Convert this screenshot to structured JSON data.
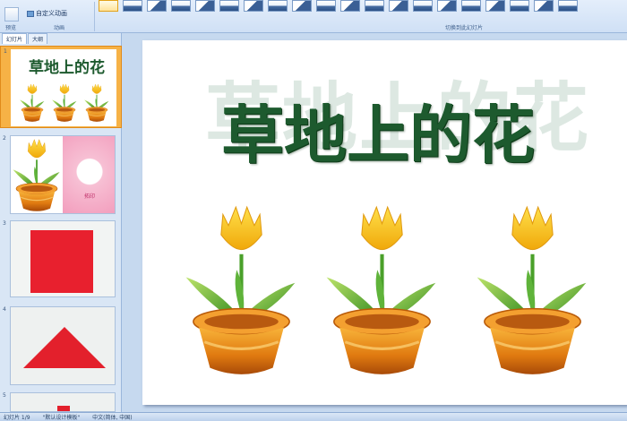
{
  "ribbon": {
    "custom_animation_label": "自定义动画",
    "group_preview_label": "预览",
    "group_animation_label": "动画",
    "group_transition_label": "切换到此幻灯片"
  },
  "left_pane": {
    "tab_slides": "幻灯片",
    "tab_outline": "大纲",
    "slides": [
      {
        "number": "1",
        "title": "草地上的花"
      },
      {
        "number": "2",
        "caption": "拓印"
      },
      {
        "number": "3"
      },
      {
        "number": "4"
      },
      {
        "number": "5"
      }
    ]
  },
  "slide": {
    "title": "草地上的花"
  },
  "status_bar": {
    "slide_position": "幻灯片 1/9",
    "theme": "\"默认设计模板\"",
    "language": "中文(简体, 中国)"
  },
  "colors": {
    "title_green": "#1d5a2e",
    "ribbon_blue": "#cfe0f5",
    "selection_orange": "#f0a030"
  }
}
